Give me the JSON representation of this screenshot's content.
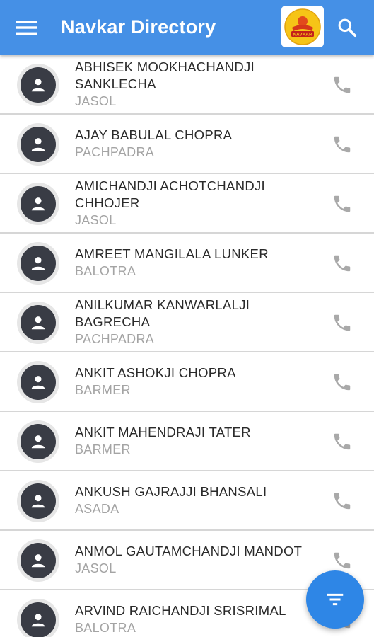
{
  "app_bar": {
    "title": "Navkar Directory",
    "color": "#4590e6",
    "logo_text": "NAVKAR",
    "icons": [
      "menu-icon",
      "app-logo",
      "search-icon"
    ]
  },
  "contacts": [
    {
      "name": "ABHISEK MOOKHACHANDJI SANKLECHA",
      "place": "JASOL"
    },
    {
      "name": "AJAY BABULAL CHOPRA",
      "place": "PACHPADRA"
    },
    {
      "name": "AMICHANDJI ACHOTCHANDJI CHHOJER",
      "place": "JASOL"
    },
    {
      "name": "AMREET MANGILALA LUNKER",
      "place": "BALOTRA"
    },
    {
      "name": "ANILKUMAR KANWARLALJI BAGRECHA",
      "place": "PACHPADRA"
    },
    {
      "name": "ANKIT ASHOKJI CHOPRA",
      "place": "BARMER"
    },
    {
      "name": "ANKIT MAHENDRAJI TATER",
      "place": "BARMER"
    },
    {
      "name": "ANKUSH GAJRAJJI BHANSALI",
      "place": "ASADA"
    },
    {
      "name": "ANMOL GAUTAMCHANDJI MANDOT",
      "place": "JASOL"
    },
    {
      "name": "ARVIND RAICHANDJI SRISRIMAL",
      "place": "BALOTRA"
    }
  ],
  "row_icons": [
    "person-icon",
    "phone-icon"
  ],
  "fab": {
    "icon": "filter-icon",
    "color": "#2e86e6"
  }
}
